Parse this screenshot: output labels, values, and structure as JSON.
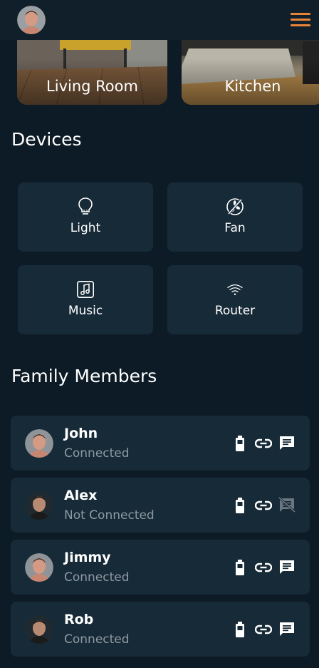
{
  "header": {
    "avatar_icon": "user-avatar-icon",
    "menu_icon": "hamburger-menu-icon",
    "accent": "#e8833a"
  },
  "rooms": [
    {
      "label": "Living Room"
    },
    {
      "label": "Kitchen"
    }
  ],
  "devices_section": {
    "title": "Devices"
  },
  "devices": [
    {
      "label": "Light",
      "icon": "lightbulb-icon"
    },
    {
      "label": "Fan",
      "icon": "fan-off-icon"
    },
    {
      "label": "Music",
      "icon": "music-note-icon"
    },
    {
      "label": "Router",
      "icon": "wifi-icon"
    }
  ],
  "family_section": {
    "title": "Family Members"
  },
  "members": [
    {
      "name": "John",
      "status": "Connected",
      "message_enabled": true
    },
    {
      "name": "Alex",
      "status": "Not Connected",
      "message_enabled": false
    },
    {
      "name": "Jimmy",
      "status": "Connected",
      "message_enabled": true
    },
    {
      "name": "Rob",
      "status": "Connected",
      "message_enabled": true
    }
  ],
  "colors": {
    "background": "#0d1b26",
    "card": "#172a37",
    "muted_text": "#8e9aa3"
  }
}
